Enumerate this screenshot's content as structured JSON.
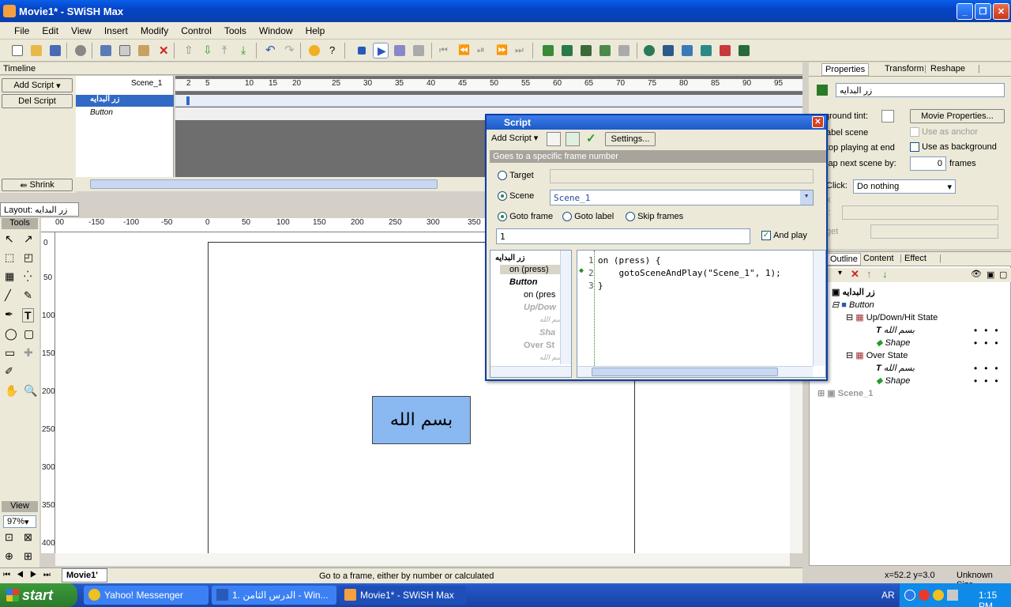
{
  "window": {
    "title": "Movie1* - SWiSH Max"
  },
  "menu": [
    "File",
    "Edit",
    "View",
    "Insert",
    "Modify",
    "Control",
    "Tools",
    "Window",
    "Help"
  ],
  "timeline": {
    "tab": "Timeline",
    "add_script": "Add Script",
    "del_script": "Del Script",
    "shrink": "Shrink",
    "scene": "Scene_1",
    "frames": [
      "2",
      "5",
      "10",
      "15",
      "20",
      "25",
      "30",
      "35",
      "40",
      "45",
      "50",
      "55",
      "60",
      "65",
      "70",
      "75",
      "80",
      "85",
      "90",
      "95"
    ],
    "rows": [
      {
        "name": "زر البدايه"
      },
      {
        "name": "Button"
      }
    ]
  },
  "layout": {
    "tab": "Layout: زر البدايه",
    "hticks": [
      "00",
      "-150",
      "-100",
      "-50",
      "0",
      "50",
      "100",
      "150",
      "200",
      "250",
      "300",
      "350"
    ],
    "vticks": [
      "0",
      "50",
      "100",
      "150",
      "200",
      "250",
      "300",
      "350",
      "400"
    ],
    "button_text": "بسم الله",
    "movie_tab": "Movie1'"
  },
  "tools": {
    "header": "Tools",
    "view_header": "View",
    "zoom": "97%"
  },
  "script": {
    "title": "Script",
    "add_script": "Add Script",
    "settings": "Settings...",
    "description": "Goes to a specific frame number",
    "target_label": "Target",
    "scene_label": "Scene",
    "scene_value": "Scene_1",
    "goto_frame": "Goto frame",
    "goto_label": "Goto label",
    "skip_frames": "Skip frames",
    "frame_value": "1",
    "and_play": "And play",
    "tree": [
      "زر البدايه",
      "on (press)",
      "Button",
      "on (pres",
      "Up/Dow",
      "بسم الله",
      "Sha",
      "Over St",
      "بسم الله"
    ],
    "code_lines": [
      {
        "num": "1",
        "text": "on (press) {"
      },
      {
        "num": "2",
        "text": "    gotoSceneAndPlay(\"Scene_1\", 1);"
      },
      {
        "num": "3",
        "text": "}"
      }
    ]
  },
  "properties": {
    "tabs": [
      "Properties",
      "Transform",
      "Reshape"
    ],
    "name": "زر البدايه",
    "bg_tint": "ground tint:",
    "movie_props": "Movie Properties...",
    "label_scene": "abel scene",
    "use_anchor": "Use as anchor",
    "stop_end": "top playing at end",
    "use_bg": "Use as background",
    "map_next": "lap next scene by:",
    "frames_value": "0",
    "frames": "frames",
    "click": "Click:",
    "click_value": "Do nothing",
    "k": "k",
    "l": "l:",
    "target": "get"
  },
  "outline": {
    "tabs": [
      "Outline",
      "Content",
      "Effect"
    ],
    "t_label": "t",
    "items": [
      {
        "label": "زر البدايه"
      },
      {
        "label": "Button"
      },
      {
        "label": "Up/Down/Hit State"
      },
      {
        "label": "بسم الله"
      },
      {
        "label": "Shape"
      },
      {
        "label": "Over State"
      },
      {
        "label": "بسم الله"
      },
      {
        "label": "Shape"
      },
      {
        "label": "Scene_1"
      }
    ]
  },
  "status": {
    "message": "Go to a frame, either by number or calculated",
    "coords": "x=52.2 y=3.0",
    "size": "Unknown Size"
  },
  "taskbar": {
    "start": "start",
    "tasks": [
      "Yahoo! Messenger",
      "1. الدرس الثامن - Win...",
      "Movie1* - SWiSH Max"
    ],
    "lang": "AR",
    "time": "1:15 PM"
  }
}
